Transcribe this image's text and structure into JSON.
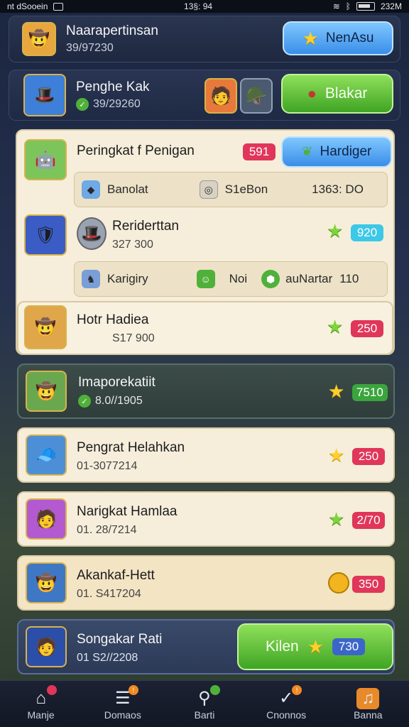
{
  "status_bar": {
    "left_text": "nt dSooein",
    "time": "13§: 94",
    "right_text": "232M"
  },
  "header": {
    "player": {
      "name": "Naarapertinsan",
      "score": "39/97230"
    },
    "top_button_label": "NenAsu",
    "second": {
      "name": "Penghe Kak",
      "score": "39/29260"
    },
    "action_button_label": "Blakar"
  },
  "panel": {
    "title": "Peringkat f Penigan",
    "title_badge": "591",
    "handiger_label": "Hardiger",
    "subbar1": {
      "col1": "Banolat",
      "col2": "S1eBon",
      "col3": "1363: DO"
    },
    "row2": {
      "name": "Reriderttan",
      "sub": "327 300",
      "badge": "920"
    },
    "subbar2": {
      "col1": "Karigiry",
      "col2": "Noi",
      "col3": "auNartar",
      "col4": "110"
    },
    "row3": {
      "name": "Hotr Hadiea",
      "sub": "S17 900",
      "badge": "250"
    }
  },
  "cards": [
    {
      "name": "Imaporekatiit",
      "sub": "8.0//1905",
      "badge": "7510",
      "badge_color": "green",
      "star": "gold"
    },
    {
      "name": "Pengrat Helahkan",
      "sub": "01-3077214",
      "badge": "250",
      "badge_color": "red",
      "star": "gold"
    },
    {
      "name": "Narigkat Hamlaa",
      "sub": "01. 28/7214",
      "badge": "2/70",
      "badge_color": "red",
      "star": "green"
    },
    {
      "name": "Akankaf-Hett",
      "sub": "01. S417204",
      "badge": "350",
      "badge_color": "red",
      "star": "coin"
    }
  ],
  "last_card": {
    "name": "Songakar Rati",
    "sub": "01 S2//2208",
    "button_label": "Kilen",
    "badge": "730"
  },
  "bottom_nav": [
    {
      "label": "Manje",
      "icon": "home-icon"
    },
    {
      "label": "Domaos",
      "icon": "messages-icon"
    },
    {
      "label": "Barti",
      "icon": "search-icon"
    },
    {
      "label": "Cnonnos",
      "icon": "check-icon"
    },
    {
      "label": "Banna",
      "icon": "music-icon"
    }
  ],
  "colors": {
    "accent_green": "#3fa424",
    "accent_blue": "#3a8ee8",
    "badge_red": "#e0365a"
  }
}
